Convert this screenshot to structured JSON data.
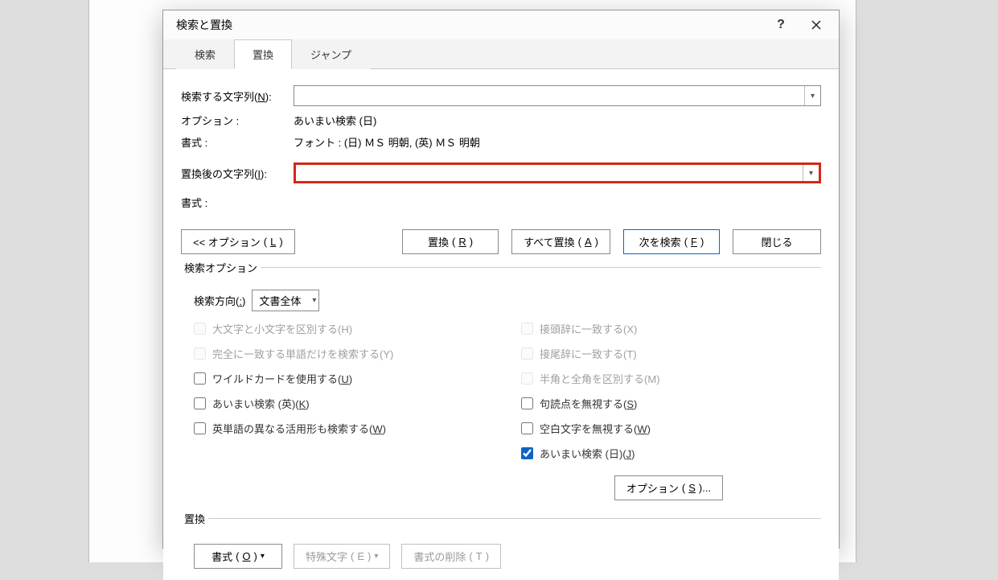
{
  "dialog": {
    "title": "検索と置換",
    "help_glyph": "?"
  },
  "tabs": {
    "find": "検索",
    "replace": "置換",
    "goto": "ジャンプ"
  },
  "fields": {
    "find_label_pre": "検索する文字列",
    "find_accel": "N",
    "find_value": "",
    "options_label": "オプション :",
    "options_value": "あいまい検索 (日)",
    "format_label": "書式 :",
    "format_value_find": "フォント : (日) ＭＳ 明朝, (英) ＭＳ 明朝",
    "replace_label_pre": "置換後の文字列",
    "replace_accel": "I",
    "replace_value": "",
    "format_value_replace": ""
  },
  "buttons": {
    "options_toggle_pre": "<< オプション",
    "options_toggle_accel": "L",
    "replace_pre": "置換",
    "replace_accel": "R",
    "replace_all_pre": "すべて置換",
    "replace_all_accel": "A",
    "find_next_pre": "次を検索",
    "find_next_accel": "F",
    "close": "閉じる",
    "sl_options_pre": "オプション",
    "sl_options_accel": "S",
    "format_pre": "書式",
    "format_accel": "O",
    "special_pre": "特殊文字",
    "special_accel": "E",
    "no_format_pre": "書式の削除",
    "no_format_accel": "T"
  },
  "search_options": {
    "legend": "検索オプション",
    "direction_label": "検索方向",
    "direction_accel": ":",
    "direction_value": "文書全体"
  },
  "checks": {
    "left": [
      {
        "label": "大文字と小文字を区別する",
        "accel": "H"
      },
      {
        "label": "完全に一致する単語だけを検索する",
        "accel": "Y"
      },
      {
        "label": "ワイルドカードを使用する",
        "accel": "U"
      },
      {
        "label": "あいまい検索 (英)",
        "accel": "K"
      },
      {
        "label": "英単語の異なる活用形も検索する",
        "accel": "W"
      }
    ],
    "right": [
      {
        "label": "接頭辞に一致する",
        "accel": "X"
      },
      {
        "label": "接尾辞に一致する",
        "accel": "T"
      },
      {
        "label": "半角と全角を区別する",
        "accel": "M"
      },
      {
        "label": "句読点を無視する",
        "accel": "S"
      },
      {
        "label": "空白文字を無視する",
        "accel": "W"
      },
      {
        "label": "あいまい検索 (日)",
        "accel": "J"
      }
    ]
  },
  "replace_group": {
    "legend": "置換"
  }
}
